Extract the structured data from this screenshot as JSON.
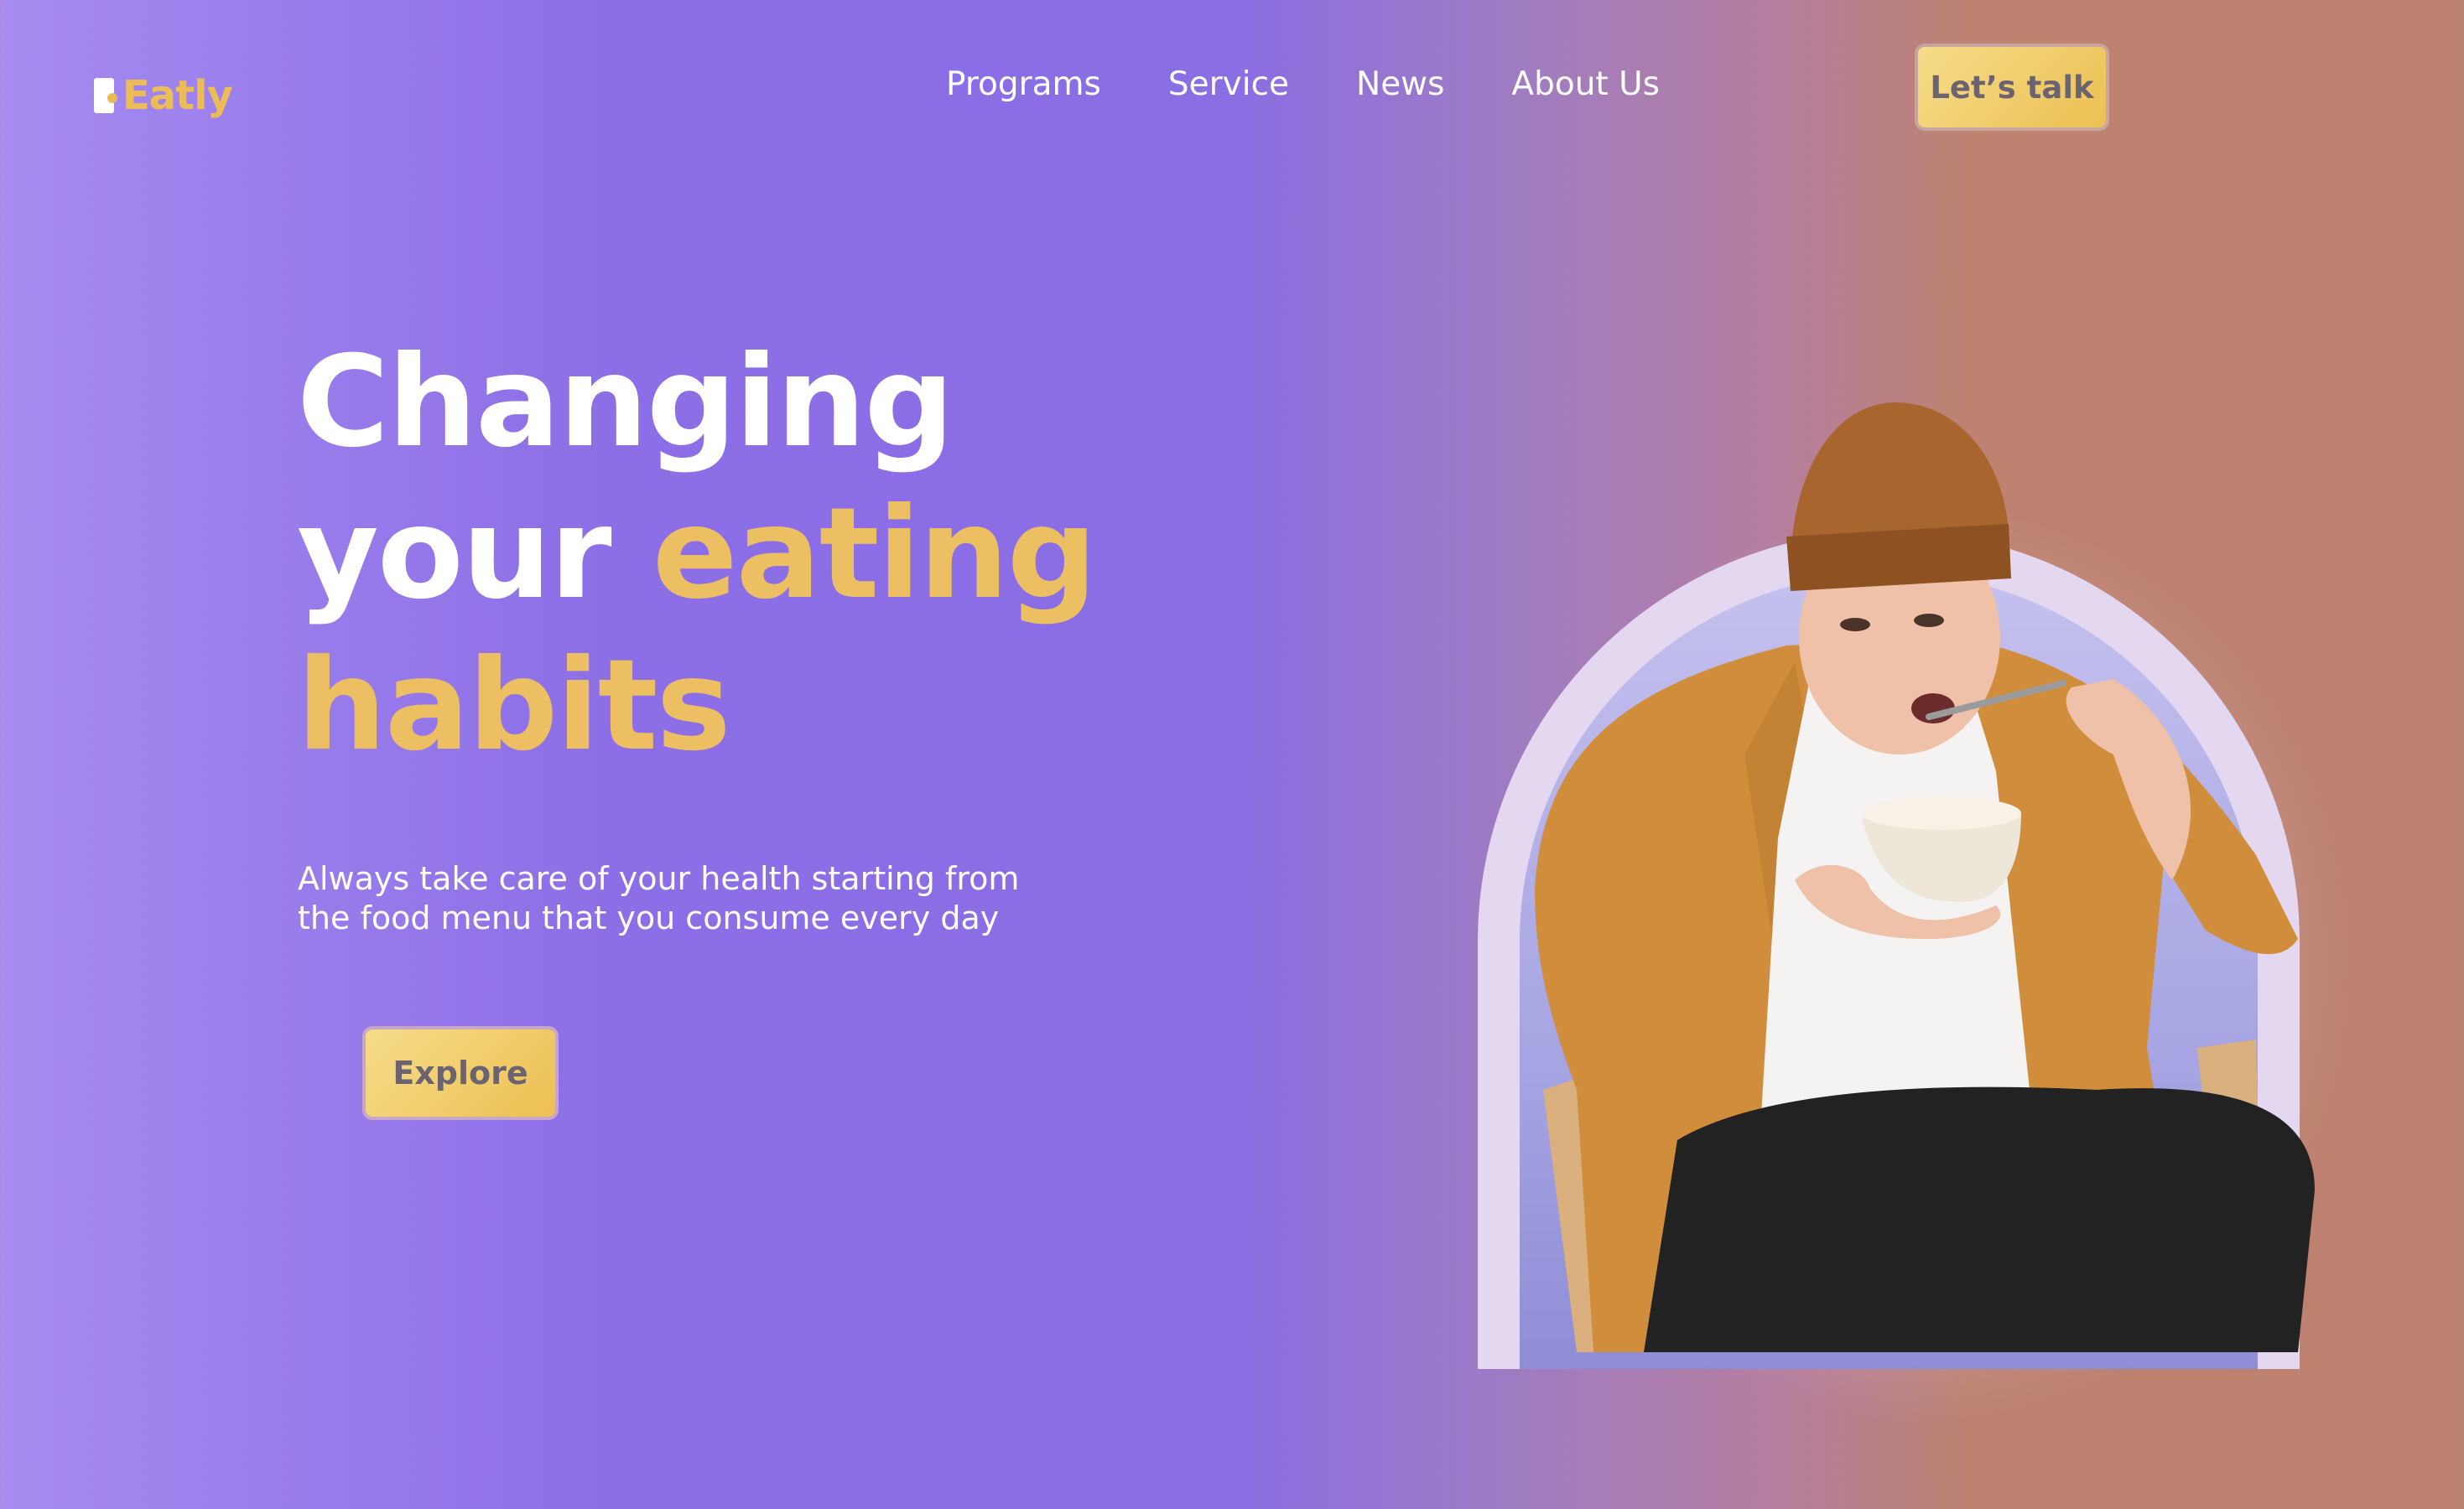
{
  "brand": {
    "name": "Eatly",
    "accent_color": "#ecbd56"
  },
  "nav": {
    "items": [
      {
        "label": "Programs"
      },
      {
        "label": "Service"
      },
      {
        "label": "News"
      },
      {
        "label": "About Us"
      }
    ],
    "cta_label": "Let’s talk"
  },
  "hero": {
    "headline_line1": "Changing",
    "headline_line2_plain": "your ",
    "headline_line2_accent": "eating",
    "headline_line3_accent": "habits",
    "subtext": "Always take care of your health starting from the food menu that you consume every day",
    "cta_label": "Explore"
  },
  "image": {
    "subject": "person-eating-from-bowl",
    "arch_color": "#e4d8f1"
  }
}
